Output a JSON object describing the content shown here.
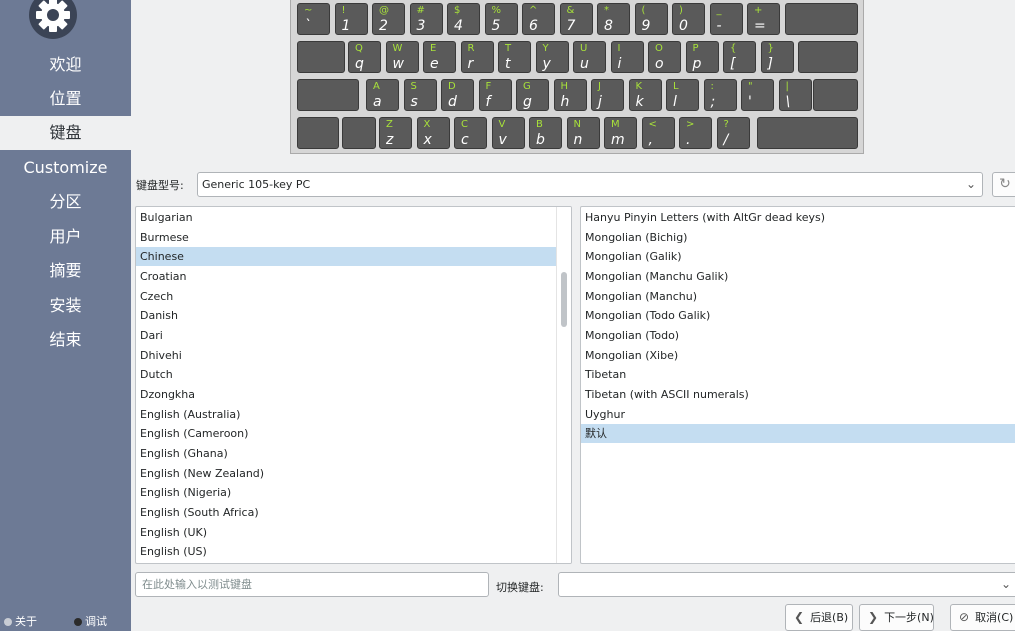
{
  "sidebar": {
    "items": [
      {
        "label": "欢迎"
      },
      {
        "label": "位置"
      },
      {
        "label": "键盘"
      },
      {
        "label": "Customize"
      },
      {
        "label": "分区"
      },
      {
        "label": "用户"
      },
      {
        "label": "摘要"
      },
      {
        "label": "安装"
      },
      {
        "label": "结束"
      }
    ],
    "active_index": 2,
    "about_label": "关于",
    "debug_label": "调试"
  },
  "keyboard": {
    "row1": [
      {
        "up": "~",
        "lo": "`"
      },
      {
        "up": "!",
        "lo": "1"
      },
      {
        "up": "@",
        "lo": "2"
      },
      {
        "up": "#",
        "lo": "3"
      },
      {
        "up": "$",
        "lo": "4"
      },
      {
        "up": "%",
        "lo": "5"
      },
      {
        "up": "^",
        "lo": "6"
      },
      {
        "up": "&",
        "lo": "7"
      },
      {
        "up": "*",
        "lo": "8"
      },
      {
        "up": "(",
        "lo": "9"
      },
      {
        "up": ")",
        "lo": "0"
      },
      {
        "up": "_",
        "lo": "-"
      },
      {
        "up": "+",
        "lo": "="
      }
    ],
    "row2": [
      {
        "up": "Q",
        "lo": "q"
      },
      {
        "up": "W",
        "lo": "w"
      },
      {
        "up": "E",
        "lo": "e"
      },
      {
        "up": "R",
        "lo": "r"
      },
      {
        "up": "T",
        "lo": "t"
      },
      {
        "up": "Y",
        "lo": "y"
      },
      {
        "up": "U",
        "lo": "u"
      },
      {
        "up": "I",
        "lo": "i"
      },
      {
        "up": "O",
        "lo": "o"
      },
      {
        "up": "P",
        "lo": "p"
      },
      {
        "up": "{",
        "lo": "["
      },
      {
        "up": "}",
        "lo": "]"
      }
    ],
    "row3": [
      {
        "up": "A",
        "lo": "a"
      },
      {
        "up": "S",
        "lo": "s"
      },
      {
        "up": "D",
        "lo": "d"
      },
      {
        "up": "F",
        "lo": "f"
      },
      {
        "up": "G",
        "lo": "g"
      },
      {
        "up": "H",
        "lo": "h"
      },
      {
        "up": "J",
        "lo": "j"
      },
      {
        "up": "K",
        "lo": "k"
      },
      {
        "up": "L",
        "lo": "l"
      },
      {
        "up": ":",
        "lo": ";"
      },
      {
        "up": "\"",
        "lo": "'"
      },
      {
        "up": "|",
        "lo": "\\"
      }
    ],
    "row4": [
      {
        "up": "Z",
        "lo": "z"
      },
      {
        "up": "X",
        "lo": "x"
      },
      {
        "up": "C",
        "lo": "c"
      },
      {
        "up": "V",
        "lo": "v"
      },
      {
        "up": "B",
        "lo": "b"
      },
      {
        "up": "N",
        "lo": "n"
      },
      {
        "up": "M",
        "lo": "m"
      },
      {
        "up": "<",
        "lo": ","
      },
      {
        "up": ">",
        "lo": "."
      },
      {
        "up": "?",
        "lo": "/"
      }
    ]
  },
  "model": {
    "label": "键盘型号:",
    "value": "Generic 105-key PC"
  },
  "layouts": {
    "items": [
      "Bulgarian",
      "Burmese",
      "Chinese",
      "Croatian",
      "Czech",
      "Danish",
      "Dari",
      "Dhivehi",
      "Dutch",
      "Dzongkha",
      "English (Australia)",
      "English (Cameroon)",
      "English (Ghana)",
      "English (New Zealand)",
      "English (Nigeria)",
      "English (South Africa)",
      "English (UK)",
      "English (US)"
    ],
    "selected_index": 2
  },
  "variants": {
    "items": [
      "Hanyu Pinyin Letters (with AltGr dead keys)",
      "Mongolian (Bichig)",
      "Mongolian (Galik)",
      "Mongolian (Manchu Galik)",
      "Mongolian (Manchu)",
      "Mongolian (Todo Galik)",
      "Mongolian (Todo)",
      "Mongolian (Xibe)",
      "Tibetan",
      "Tibetan (with ASCII numerals)",
      "Uyghur",
      "默认"
    ],
    "selected_index": 11
  },
  "test_input": {
    "placeholder": "在此处输入以测试键盘",
    "value": ""
  },
  "switch": {
    "label": "切换键盘:",
    "value": ""
  },
  "buttons": {
    "back": "后退(B)",
    "next": "下一步(N)",
    "cancel": "取消(C)"
  },
  "colors": {
    "sidebar_bg": "#6d7a95",
    "key_bg": "#5a5a5a",
    "key_upper": "#a8e23a",
    "selection": "#c4ddf1"
  }
}
